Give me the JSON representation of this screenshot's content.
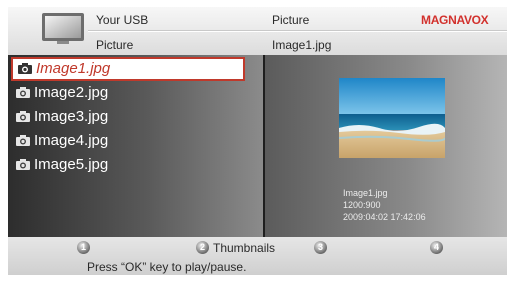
{
  "header": {
    "source_label": "Your USB",
    "breadcrumb": "Picture",
    "category": "Picture",
    "current_file": "Image1.jpg",
    "brand": "MAGNAVOX",
    "brand_color": "#d2312d"
  },
  "file_list": {
    "item_icon": "camera-icon",
    "items": [
      {
        "label": "Image1.jpg",
        "selected": true
      },
      {
        "label": "Image2.jpg",
        "selected": false
      },
      {
        "label": "Image3.jpg",
        "selected": false
      },
      {
        "label": "Image4.jpg",
        "selected": false
      },
      {
        "label": "Image5.jpg",
        "selected": false
      }
    ]
  },
  "preview": {
    "thumbnail": "beach-thumbnail",
    "filename": "Image1.jpg",
    "resolution": "1200:900",
    "datetime": "2009:04:02 17:42:06"
  },
  "footer": {
    "buttons": [
      {
        "number": "1",
        "label": ""
      },
      {
        "number": "2",
        "label": "Thumbnails"
      },
      {
        "number": "3",
        "label": ""
      },
      {
        "number": "4",
        "label": ""
      }
    ],
    "hint": "Press “OK” key to play/pause."
  }
}
